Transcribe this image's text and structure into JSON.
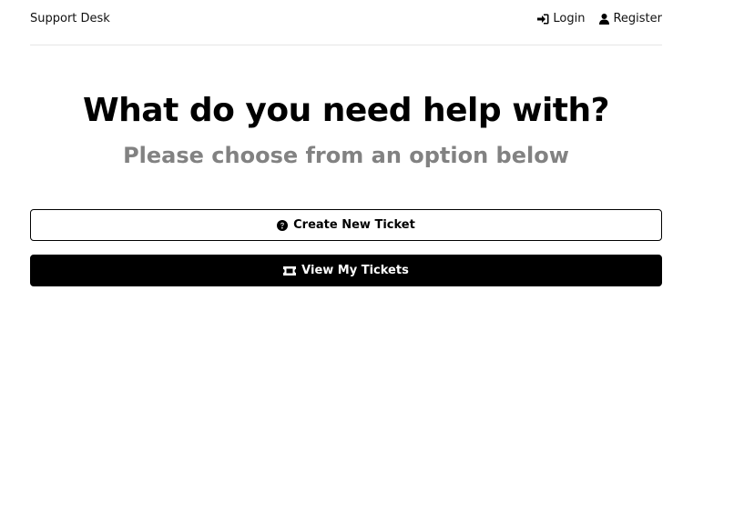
{
  "header": {
    "brand": "Support Desk",
    "nav": [
      {
        "label": "Login",
        "icon": "sign-in-icon"
      },
      {
        "label": "Register",
        "icon": "user-icon"
      }
    ]
  },
  "main": {
    "title": "What do you need help with?",
    "subtitle": "Please choose from an option below",
    "actions": [
      {
        "label": "Create New Ticket",
        "icon": "question-circle-icon",
        "style": "outline"
      },
      {
        "label": "View My Tickets",
        "icon": "ticket-icon",
        "style": "solid"
      }
    ]
  },
  "colors": {
    "primary": "#000000",
    "background": "#ffffff",
    "subtitle": "#828282",
    "divider": "#e6e6e6"
  }
}
